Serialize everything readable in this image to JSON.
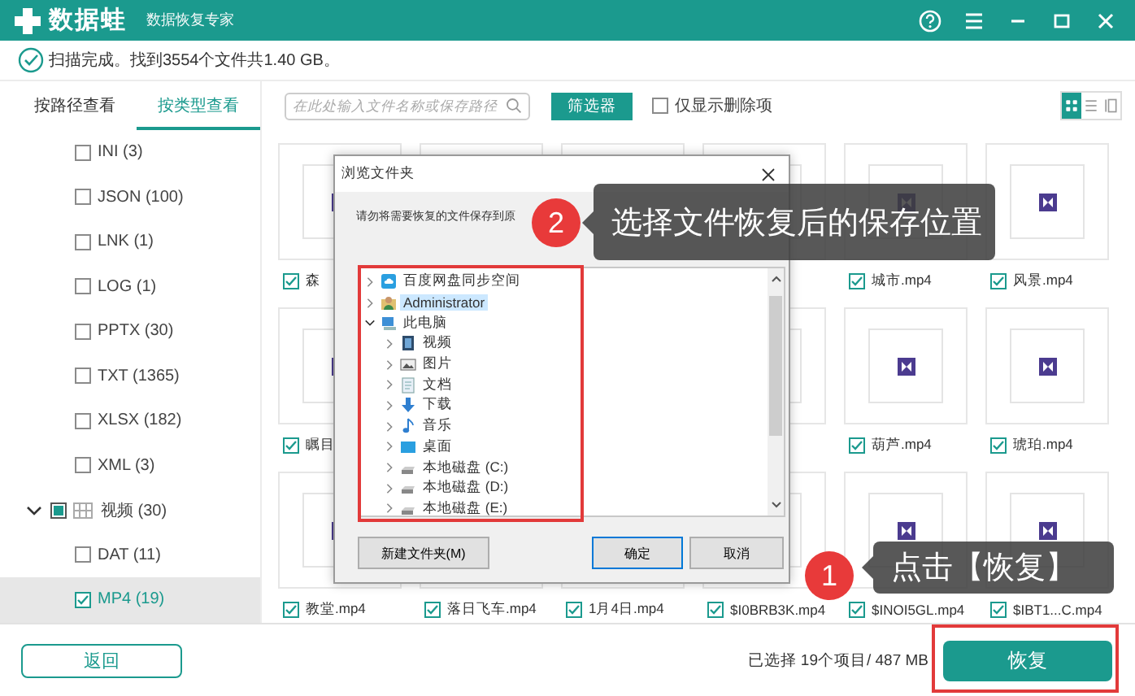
{
  "window": {
    "app_name": "数据蛙",
    "subtitle": "数据恢复专家"
  },
  "scan_status": "扫描完成。找到3554个文件共1.40 GB。",
  "view_tabs": [
    {
      "label": "按路径查看",
      "selected": false
    },
    {
      "label": "按类型查看",
      "selected": true
    }
  ],
  "type_tree": {
    "items": [
      {
        "label": "INI (3)",
        "checked": false,
        "selected": false
      },
      {
        "label": "JSON (100)",
        "checked": false,
        "selected": false
      },
      {
        "label": "LNK (1)",
        "checked": false,
        "selected": false
      },
      {
        "label": "LOG (1)",
        "checked": false,
        "selected": false
      },
      {
        "label": "PPTX (30)",
        "checked": false,
        "selected": false
      },
      {
        "label": "TXT (1365)",
        "checked": false,
        "selected": false
      },
      {
        "label": "XLSX (182)",
        "checked": false,
        "selected": false
      },
      {
        "label": "XML (3)",
        "checked": false,
        "selected": false
      }
    ],
    "groups": [
      {
        "label": "视频 (30)",
        "checked": false,
        "partial": true,
        "expanded": true,
        "selected": false,
        "children": [
          {
            "label": "DAT (11)",
            "checked": false,
            "selected": false
          },
          {
            "label": "MP4 (19)",
            "checked": true,
            "selected": true
          }
        ]
      }
    ]
  },
  "toolbar": {
    "search": {
      "placeholder": "在此处输入文件名称或保存路径"
    },
    "filter_button": "筛选器",
    "deleted_only": {
      "label": "仅显示删除项",
      "checked": false
    },
    "view_modes": [
      {
        "kind": "grid",
        "selected": true
      },
      {
        "kind": "list",
        "selected": false
      },
      {
        "kind": "detail",
        "selected": false
      }
    ]
  },
  "files": [
    {
      "kind": "file",
      "name": "森",
      "checked": true
    },
    {
      "kind": "covered"
    },
    {
      "kind": "covered"
    },
    {
      "kind": "covered"
    },
    {
      "kind": "file",
      "name": "城市.mp4",
      "checked": true
    },
    {
      "kind": "file",
      "name": "风景.mp4",
      "checked": true
    },
    {
      "kind": "file",
      "name": "瞩目",
      "checked": true
    },
    {
      "kind": "hidden"
    },
    {
      "kind": "hidden"
    },
    {
      "kind": "covered"
    },
    {
      "kind": "file",
      "name": "葫芦.mp4",
      "checked": true
    },
    {
      "kind": "file",
      "name": "琥珀.mp4",
      "checked": true
    },
    {
      "kind": "file",
      "name": "教堂.mp4",
      "checked": true
    },
    {
      "kind": "file",
      "name": "落日飞车.mp4",
      "checked": true
    },
    {
      "kind": "file",
      "name": "1月4日.mp4",
      "checked": true
    },
    {
      "kind": "file",
      "name": "$I0BRB3K.mp4",
      "checked": true
    },
    {
      "kind": "file",
      "name": "$INOI5GL.mp4",
      "checked": true
    },
    {
      "kind": "file",
      "name": "$IBT1...C.mp4",
      "checked": true
    }
  ],
  "dialog": {
    "title": "浏览文件夹",
    "instruction": "请勿将需要恢复的文件保存到原",
    "folders": [
      {
        "kind": "cloud",
        "label": "百度网盘同步空间",
        "expanded": false,
        "selected": false
      },
      {
        "kind": "user",
        "label": "Administrator",
        "expanded": false,
        "selected": true
      },
      {
        "kind": "pc",
        "label": "此电脑",
        "expanded": true,
        "selected": false,
        "children": [
          {
            "kind": "videos",
            "label": "视频",
            "expanded": false,
            "selected": false
          },
          {
            "kind": "pictures",
            "label": "图片",
            "expanded": false,
            "selected": false
          },
          {
            "kind": "documents",
            "label": "文档",
            "expanded": false,
            "selected": false
          },
          {
            "kind": "downloads",
            "label": "下载",
            "expanded": false,
            "selected": false
          },
          {
            "kind": "music",
            "label": "音乐",
            "expanded": false,
            "selected": false
          },
          {
            "kind": "desktop",
            "label": "桌面",
            "expanded": false,
            "selected": false
          },
          {
            "kind": "drive",
            "label": "本地磁盘 (C:)",
            "expanded": false,
            "selected": false
          },
          {
            "kind": "drive",
            "label": "本地磁盘 (D:)",
            "expanded": false,
            "selected": false
          },
          {
            "kind": "drive",
            "label": "本地磁盘 (E:)",
            "expanded": false,
            "selected": false
          }
        ]
      }
    ],
    "buttons": [
      {
        "label": "新建文件夹(M)",
        "default": false
      },
      {
        "label": "确定",
        "default": true
      },
      {
        "label": "取消",
        "default": false
      }
    ]
  },
  "callouts": [
    {
      "number": "2",
      "text": "选择文件恢复后的保存位置"
    },
    {
      "number": "1",
      "text": "点击【恢复】"
    }
  ],
  "bottom_bar": {
    "back_button": "返回",
    "selection_summary": "已选择 19个项目/ 487 MB",
    "recover_button": "恢复"
  }
}
